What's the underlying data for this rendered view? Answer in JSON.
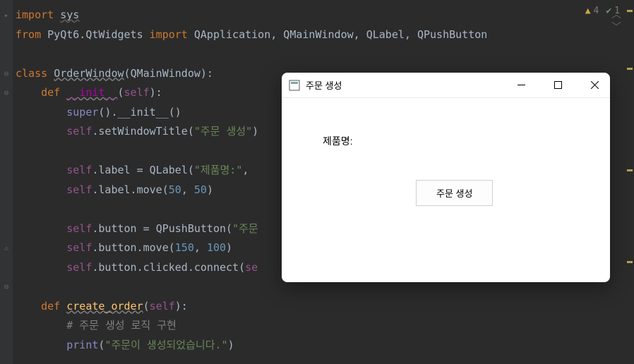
{
  "status": {
    "warnings_count": "4",
    "checks_count": "1"
  },
  "code": {
    "l1": {
      "kw": "import",
      "mod": "sys"
    },
    "l2": {
      "kw1": "from",
      "mod": "PyQt6.QtWidgets",
      "kw2": "import",
      "names": "QApplication, QMainWindow, QLabel, QPushButton"
    },
    "l4": {
      "kw": "class",
      "name": "OrderWindow",
      "base": "QMainWindow"
    },
    "l5": {
      "kw": "def",
      "fn": "__init__",
      "params": "self"
    },
    "l6": {
      "sup": "super",
      "init": "__init__"
    },
    "l7": {
      "self": "self",
      "method": "setWindowTitle",
      "str": "\"주문 생성\""
    },
    "l9": {
      "self": "self",
      "attr": "label",
      "cls": "QLabel",
      "str": "\"제품명:\""
    },
    "l10": {
      "self": "self",
      "call": "label.move",
      "n1": "50",
      "n2": "50"
    },
    "l12": {
      "self": "self",
      "attr": "button",
      "cls": "QPushButton",
      "str": "\"주문"
    },
    "l13": {
      "self": "self",
      "call": "button.move",
      "n1": "150",
      "n2": "100"
    },
    "l14": {
      "self": "self",
      "call": "button.clicked.connect",
      "arg": "se"
    },
    "l16": {
      "kw": "def",
      "fn": "create_order",
      "params": "self"
    },
    "l17": {
      "comment": "# 주문 생성 로직 구현"
    },
    "l18": {
      "fn": "print",
      "str": "\"주문이 생성되었습니다.\""
    }
  },
  "popup": {
    "title": "주문 생성",
    "label": "제품명:",
    "button": "주문 생성"
  }
}
